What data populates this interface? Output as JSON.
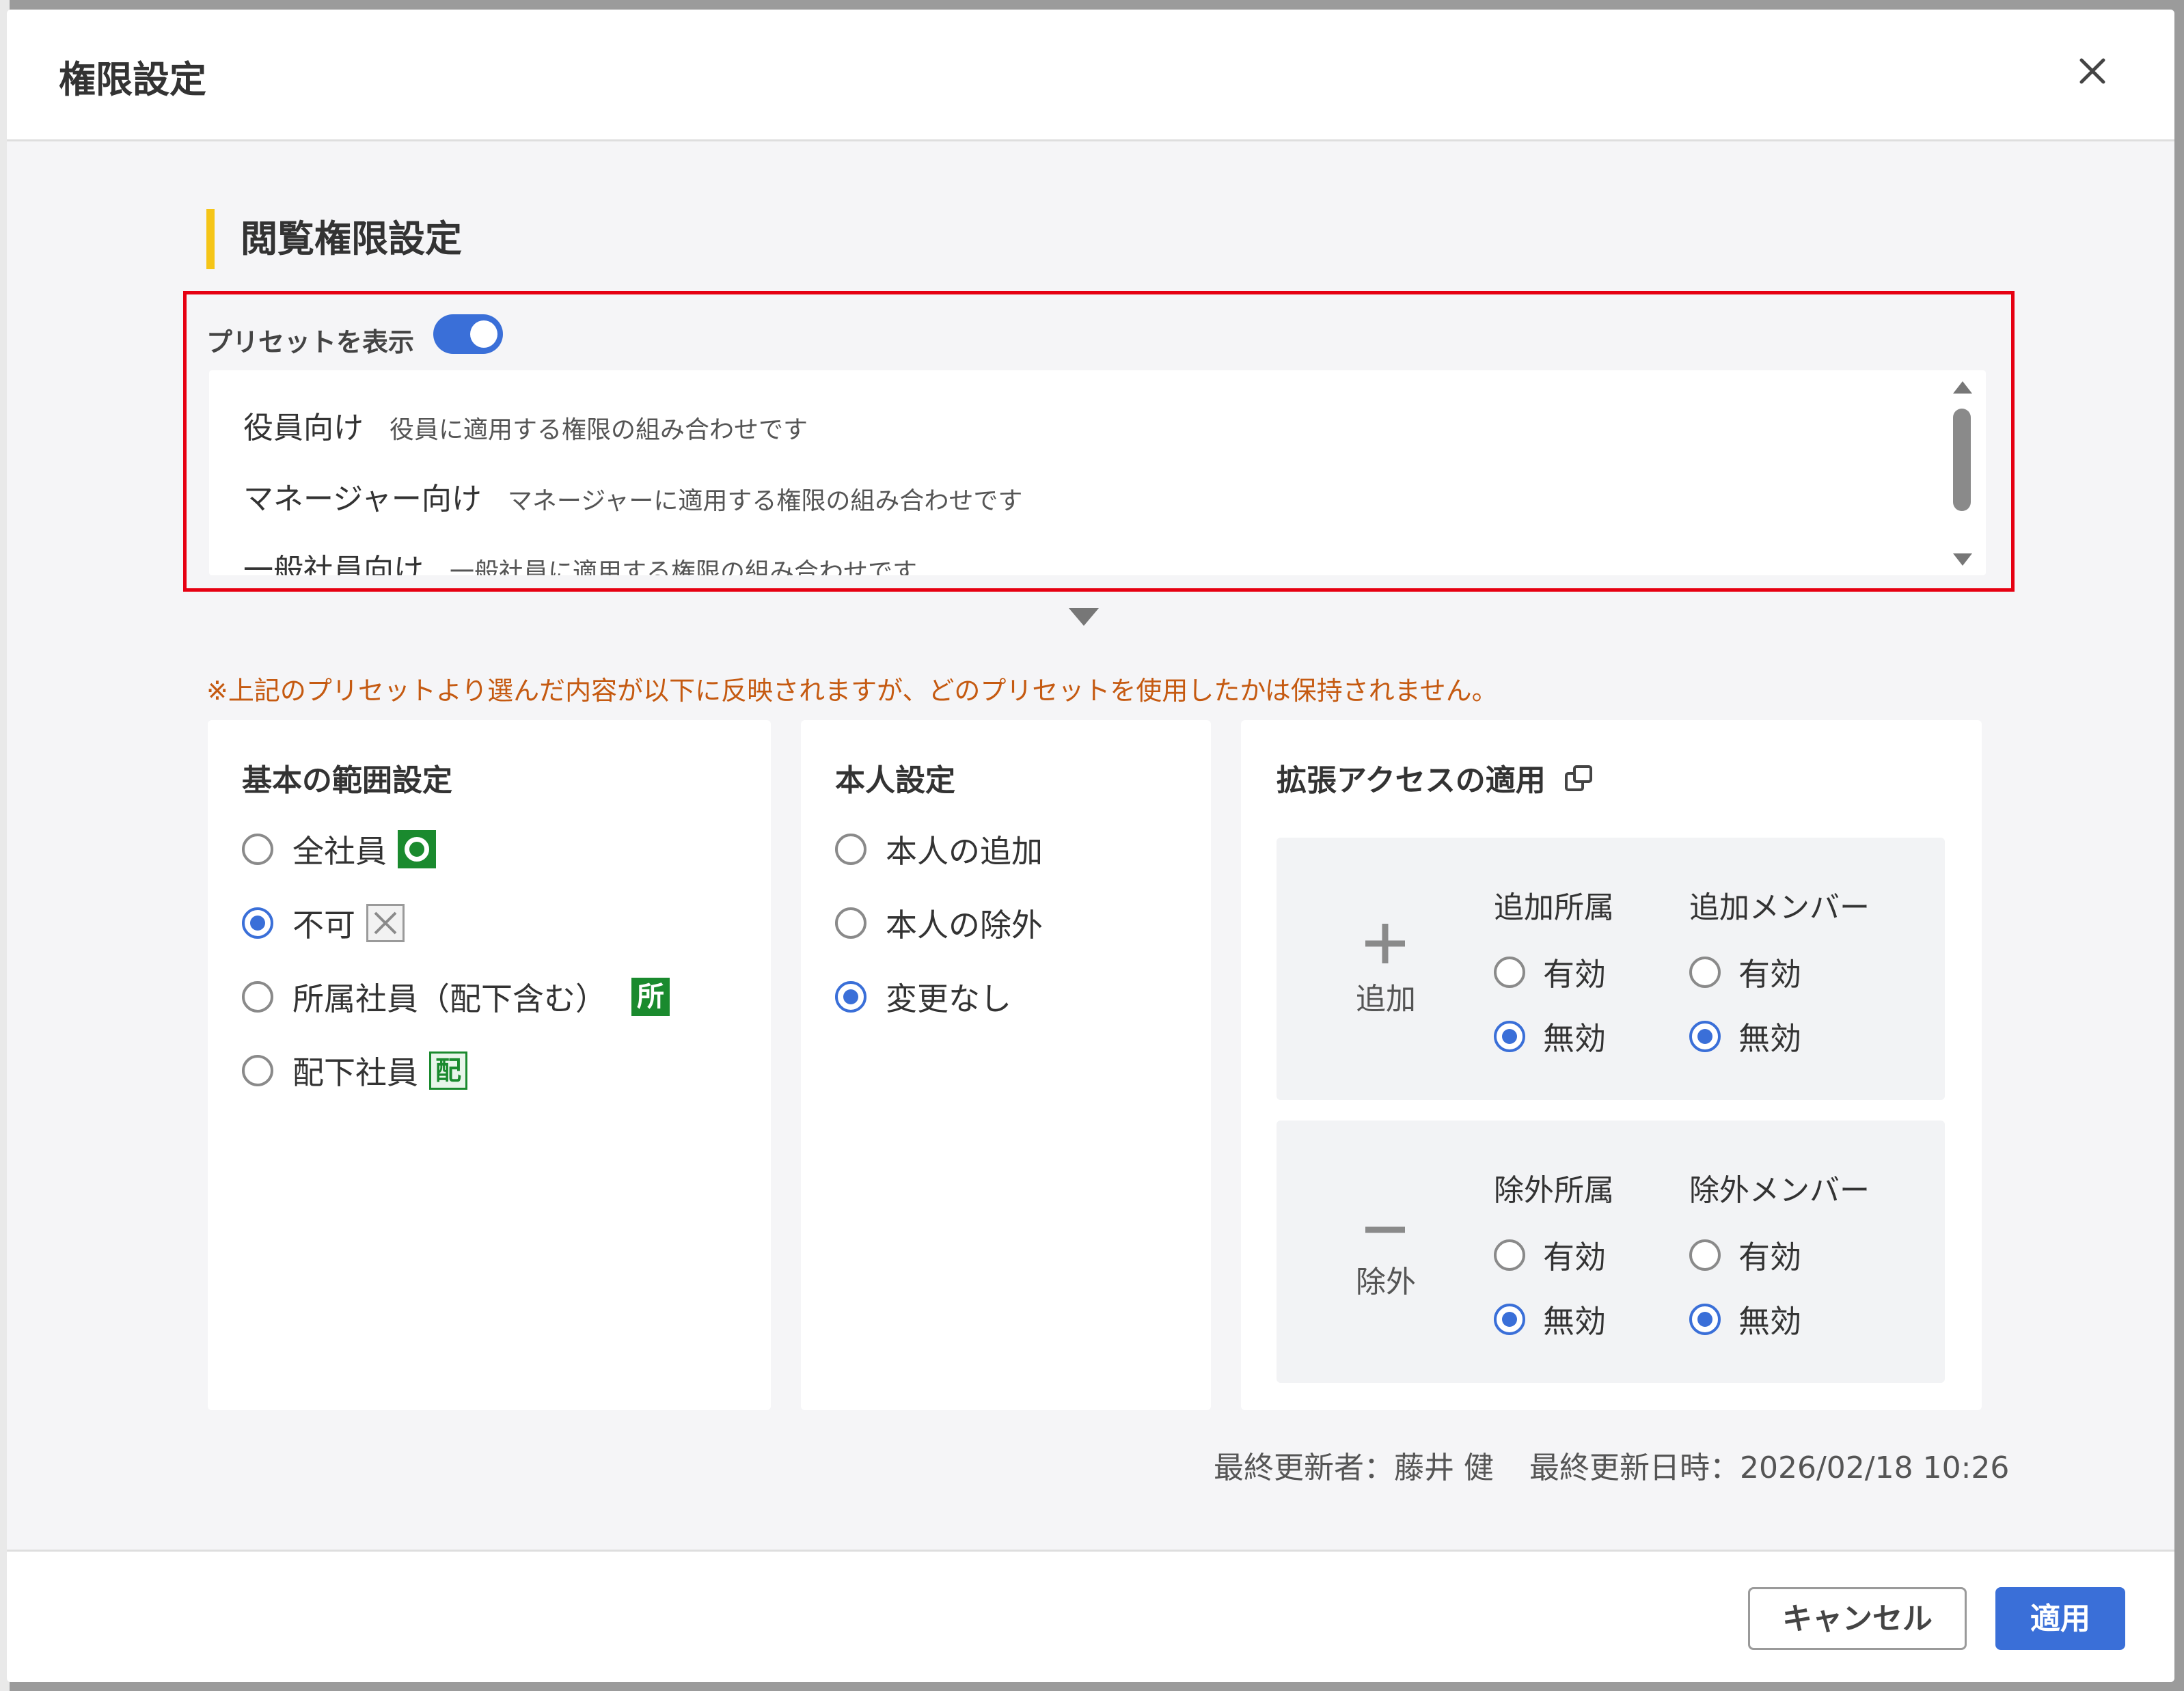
{
  "dialog": {
    "title": "権限設定",
    "close_icon": "close-icon"
  },
  "section": {
    "title": "閲覧権限設定"
  },
  "preset": {
    "toggle_label": "プリセットを表示",
    "toggle_on": true,
    "items": [
      {
        "name": "役員向け",
        "desc": "役員に適用する権限の組み合わせです"
      },
      {
        "name": "マネージャー向け",
        "desc": "マネージャーに適用する権限の組み合わせです"
      },
      {
        "name": "一般社員向け",
        "desc": "一般社員に適用する権限の組み合わせです"
      }
    ],
    "note": "※上記のプリセットより選んだ内容が以下に反映されますが、どのプリセットを使用したかは保持されません。"
  },
  "basic_scope": {
    "title": "基本の範囲設定",
    "options": [
      {
        "label": "全社員",
        "checked": false,
        "badge": "circle-badge"
      },
      {
        "label": "不可",
        "checked": true,
        "badge": "x-badge"
      },
      {
        "label": "所属社員（配下含む）",
        "checked": false,
        "badge": "所"
      },
      {
        "label": "配下社員",
        "checked": false,
        "badge": "配"
      }
    ]
  },
  "self_setting": {
    "title": "本人設定",
    "options": [
      {
        "label": "本人の追加",
        "checked": false
      },
      {
        "label": "本人の除外",
        "checked": false
      },
      {
        "label": "変更なし",
        "checked": true
      }
    ]
  },
  "extended_access": {
    "title": "拡張アクセスの適用",
    "link_icon": "external-link-icon",
    "add_panel": {
      "icon": "plus-icon",
      "label": "追加",
      "col1_head": "追加所属",
      "col2_head": "追加メンバー",
      "col1_options": [
        {
          "label": "有効",
          "checked": false
        },
        {
          "label": "無効",
          "checked": true
        }
      ],
      "col2_options": [
        {
          "label": "有効",
          "checked": false
        },
        {
          "label": "無効",
          "checked": true
        }
      ]
    },
    "exclude_panel": {
      "icon": "minus-icon",
      "label": "除外",
      "col1_head": "除外所属",
      "col2_head": "除外メンバー",
      "col1_options": [
        {
          "label": "有効",
          "checked": false
        },
        {
          "label": "無効",
          "checked": true
        }
      ],
      "col2_options": [
        {
          "label": "有効",
          "checked": false
        },
        {
          "label": "無効",
          "checked": true
        }
      ]
    }
  },
  "meta": {
    "updated_by": "最終更新者：藤井 健",
    "updated_at": "最終更新日時：2026/02/18 10:26"
  },
  "footer": {
    "cancel_label": "キャンセル",
    "apply_label": "適用"
  },
  "colors": {
    "accent": "#3a6fd8",
    "section_bar": "#f5c518",
    "highlight_border": "#e60012",
    "note_text": "#c55a11",
    "badge_green": "#1a8a2e"
  }
}
